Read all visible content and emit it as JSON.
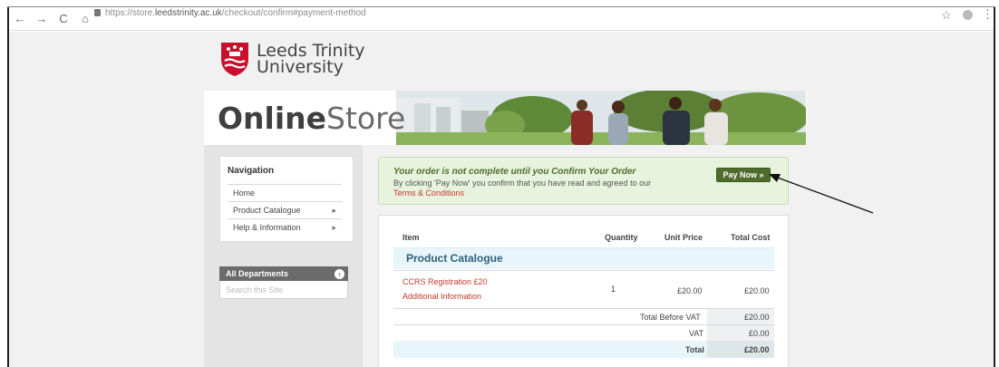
{
  "browser": {
    "url_prefix": "https://store.",
    "url_host": "leedstrinity.ac.uk",
    "url_path": "/checkout/confirm#payment-method",
    "back": "←",
    "forward": "→",
    "reload": "C",
    "home": "⌂",
    "bookmark": "☆",
    "menu": "⋮"
  },
  "logo": {
    "line1": "Leeds Trinity",
    "line2": "University"
  },
  "banner": {
    "title_bold": "Online",
    "title_light": "Store"
  },
  "sidebar": {
    "heading": "Navigation",
    "items": [
      {
        "label": "Home",
        "chevron": ""
      },
      {
        "label": "Product Catalogue",
        "chevron": "▸"
      },
      {
        "label": "Help & Information",
        "chevron": "▸"
      }
    ],
    "departments": {
      "label": "All Departments",
      "arrow": "›",
      "search_placeholder": "Search this Site"
    }
  },
  "notice": {
    "title": "Your order is not complete until you Confirm Your Order",
    "text": "By clicking 'Pay Now' you confirm that you have read and agreed to our ",
    "terms_link": "Terms & Conditions",
    "pay_button": "Pay Now »"
  },
  "order": {
    "headers": {
      "item": "Item",
      "quantity": "Quantity",
      "unit_price": "Unit Price",
      "total_cost": "Total Cost"
    },
    "category": "Product Catalogue",
    "line_item": {
      "name": "CCRS Registration £20",
      "additional": "Additional Information",
      "quantity": "1",
      "unit_price": "£20.00",
      "total": "£20.00"
    },
    "summary": {
      "before_vat_label": "Total Before VAT",
      "before_vat_value": "£20.00",
      "vat_label": "VAT",
      "vat_value": "£0.00",
      "total_label": "Total",
      "total_value": "£20.00"
    }
  },
  "colors": {
    "accent_green": "#4e6d2c",
    "link_red": "#c0392b",
    "category_blue": "#2e5f7a",
    "logo_red": "#c8102e"
  }
}
